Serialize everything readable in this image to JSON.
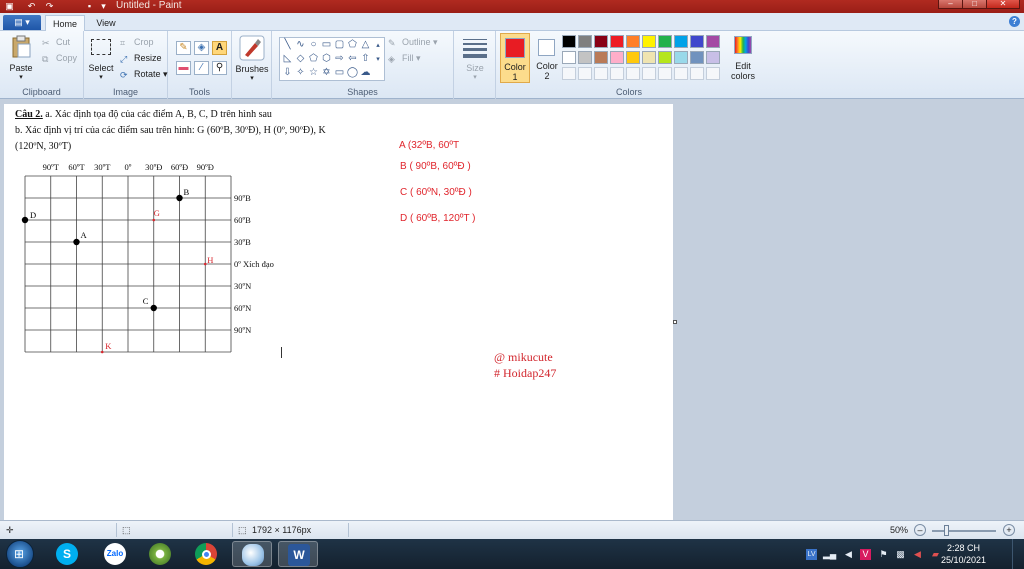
{
  "window": {
    "title": "Untitled - Paint",
    "qat_icons": [
      "paint-icon",
      "save-icon",
      "undo-icon",
      "redo-icon",
      "customize-qat-icon"
    ],
    "controls": [
      "minimize",
      "maximize",
      "close"
    ]
  },
  "tabs": [
    {
      "label": "Home",
      "active": true
    },
    {
      "label": "View",
      "active": false
    }
  ],
  "ribbon": {
    "clipboard": {
      "label": "Clipboard",
      "paste": "Paste",
      "cut": "Cut",
      "copy": "Copy"
    },
    "image": {
      "label": "Image",
      "select": "Select",
      "crop": "Crop",
      "resize": "Resize",
      "rotate": "Rotate"
    },
    "tools": {
      "label": "Tools"
    },
    "brushes": {
      "label": "Brushes"
    },
    "shapes": {
      "label": "Shapes",
      "outline": "Outline",
      "fill": "Fill"
    },
    "size": {
      "label": "Size"
    },
    "colors": {
      "label": "Colors",
      "color1": "Color\n1",
      "color1_line1": "Color",
      "color1_line2": "1",
      "color2_line1": "Color",
      "color2_line2": "2",
      "color1_value": "#e81c23",
      "color2_value": "#ffffff",
      "edit_line1": "Edit",
      "edit_line2": "colors",
      "palette": [
        "#000000",
        "#7f7f7f",
        "#880015",
        "#ed1c24",
        "#ff7f27",
        "#fff200",
        "#22b14c",
        "#00a2e8",
        "#3f48cc",
        "#a349a4",
        "#ffffff",
        "#c3c3c3",
        "#b97a57",
        "#ffaec9",
        "#ffc90e",
        "#efe4b0",
        "#b5e61d",
        "#99d9ea",
        "#7092be",
        "#c8bfe7"
      ]
    }
  },
  "document": {
    "line1_bold": "Câu 2.",
    "line1_rest": " a. Xác định tọa độ của các điểm A, B, C, D trên hình sau",
    "line2": "b. Xác định vị trí của các điểm sau trên hình: G (60ºB, 30ºĐ), H (0º, 90ºĐ), K",
    "line3": "(120ºN, 30ºT)",
    "longitude_labels": [
      "90ºT",
      "60ºT",
      "30ºT",
      "0º",
      "30ºĐ",
      "60ºĐ",
      "90ºĐ"
    ],
    "latitude_labels": [
      "90ºB",
      "60ºB",
      "30ºB",
      "0º Xích đạo",
      "30ºN",
      "60ºN",
      "90ºN"
    ],
    "points": [
      {
        "label": "A",
        "color": "#000000"
      },
      {
        "label": "B",
        "color": "#000000"
      },
      {
        "label": "C",
        "color": "#000000"
      },
      {
        "label": "D",
        "color": "#000000"
      },
      {
        "label": "G",
        "color": "#d8262d"
      },
      {
        "label": "H",
        "color": "#d8262d"
      },
      {
        "label": "K",
        "color": "#d8262d"
      }
    ],
    "answers": [
      "A (32ºB, 60ºT",
      "B ( 90ºB, 60ºĐ )",
      "C ( 60ºN, 30ºĐ )",
      "D ( 60ºB, 120ºT )"
    ],
    "signature_line1": "@ mikucute",
    "signature_line2": "# Hoidap247"
  },
  "status": {
    "image_size": "1792 × 1176px",
    "zoom": "50%"
  },
  "taskbar": {
    "apps": [
      "Skype",
      "Zalo",
      "Chrome-like",
      "Chrome",
      "Paint",
      "Word"
    ],
    "tray_icons": [
      "keyboard-icon",
      "signal-icon",
      "volume-icon",
      "vivaldi-icon",
      "flag-icon",
      "network-icon",
      "notifications-icon"
    ],
    "time": "2:28 CH",
    "date": "25/10/2021"
  }
}
